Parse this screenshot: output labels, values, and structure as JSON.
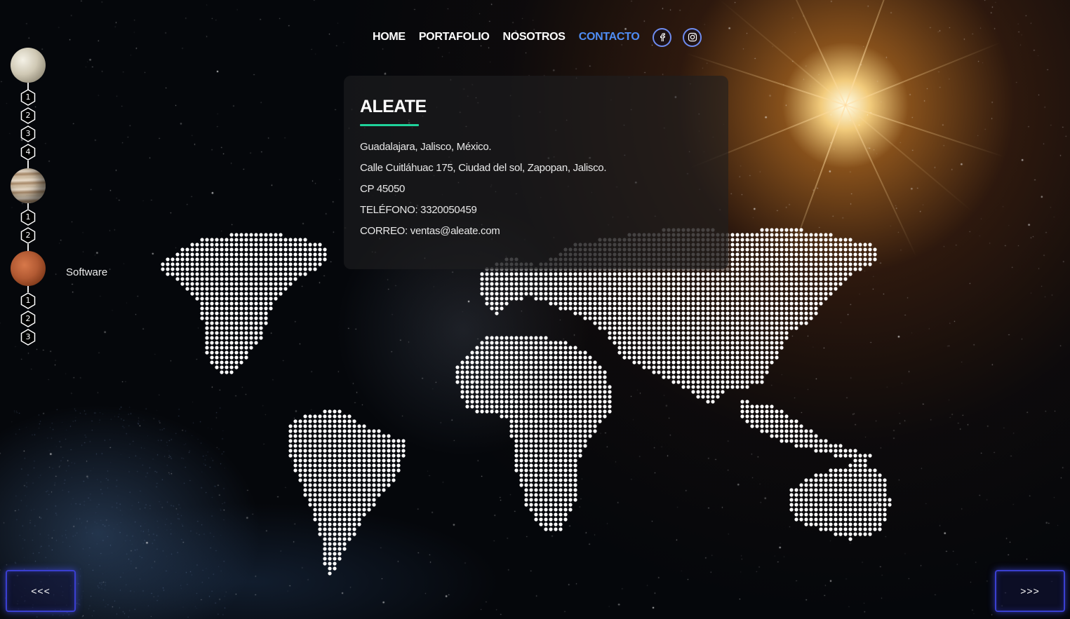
{
  "nav": {
    "items": [
      {
        "label": "HOME",
        "active": false
      },
      {
        "label": "PORTAFOLIO",
        "active": false
      },
      {
        "label": "NOSOTROS",
        "active": false
      },
      {
        "label": "CONTACTO",
        "active": true
      }
    ],
    "social": [
      "facebook-icon",
      "instagram-icon"
    ]
  },
  "contact": {
    "title": "ALEATE",
    "lines": [
      "Guadalajara, Jalisco, México.",
      "Calle Cuitláhuac 175, Ciudad del sol, Zapopan, Jalisco.",
      "CP 45050",
      "TELÉFONO: 3320050459",
      "CORREO: ventas@aleate.com"
    ]
  },
  "rail": {
    "groups": [
      {
        "planet": "moon-planet-icon",
        "steps": [
          "1",
          "2",
          "3",
          "4"
        ]
      },
      {
        "planet": "jupiter-planet-icon",
        "steps": [
          "1",
          "2"
        ]
      },
      {
        "planet": "mars-planet-icon",
        "steps": [
          "1",
          "2",
          "3"
        ],
        "label": "Software"
      }
    ]
  },
  "pager": {
    "prev_label": "<<<",
    "next_label": ">>>"
  },
  "colors": {
    "accent": "#4f8df5",
    "underline": "#1fd39a",
    "button_border": "#3a3fd0"
  }
}
